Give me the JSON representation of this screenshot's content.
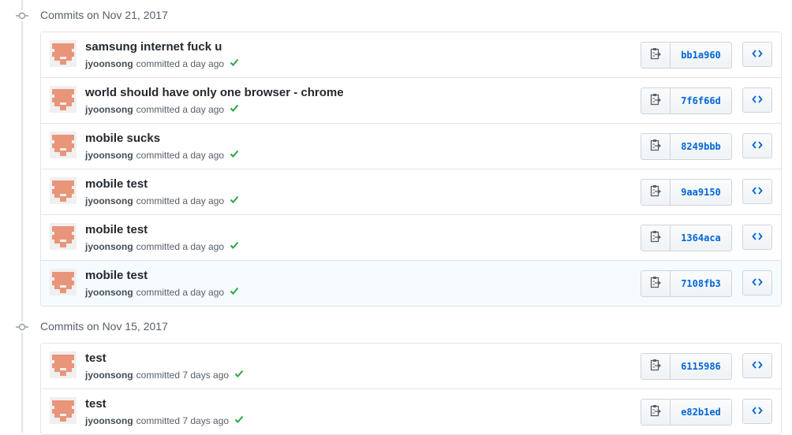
{
  "groups": [
    {
      "title": "Commits on Nov 21, 2017",
      "commits": [
        {
          "message": "samsung internet fuck u",
          "author": "jyoonsong",
          "time": "committed a day ago",
          "sha": "bb1a960"
        },
        {
          "message": "world should have only one browser - chrome",
          "author": "jyoonsong",
          "time": "committed a day ago",
          "sha": "7f6f66d"
        },
        {
          "message": "mobile sucks",
          "author": "jyoonsong",
          "time": "committed a day ago",
          "sha": "8249bbb"
        },
        {
          "message": "mobile test",
          "author": "jyoonsong",
          "time": "committed a day ago",
          "sha": "9aa9150"
        },
        {
          "message": "mobile test",
          "author": "jyoonsong",
          "time": "committed a day ago",
          "sha": "1364aca"
        },
        {
          "message": "mobile test",
          "author": "jyoonsong",
          "time": "committed a day ago",
          "sha": "7108fb3"
        }
      ]
    },
    {
      "title": "Commits on Nov 15, 2017",
      "commits": [
        {
          "message": "test",
          "author": "jyoonsong",
          "time": "committed 7 days ago",
          "sha": "6115986"
        },
        {
          "message": "test",
          "author": "jyoonsong",
          "time": "committed 7 days ago",
          "sha": "e82b1ed"
        }
      ]
    }
  ],
  "icons": {
    "avatar": "identicon-avatar",
    "status": "check-icon",
    "copy": "clipboard-icon",
    "browse": "code-icon"
  },
  "colors": {
    "link": "#0366d6",
    "success": "#28a745",
    "avatar": "#e8957a",
    "highlight_row": "#f6fbff"
  }
}
